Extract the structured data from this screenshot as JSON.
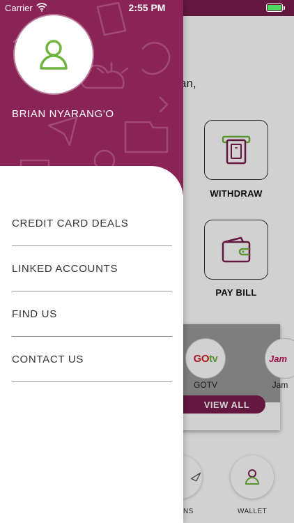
{
  "status_bar": {
    "carrier": "Carrier",
    "time": "2:55 PM",
    "battery_color": "#4cd964"
  },
  "drawer": {
    "brand_color": "#8a2356",
    "user_name": "BRIAN NYARANG'O",
    "avatar_icon": "user-icon",
    "avatar_icon_color": "#6fb43f",
    "menu": [
      {
        "label": "CREDIT CARD DEALS"
      },
      {
        "label": "LINKED ACCOUNTS"
      },
      {
        "label": "FIND US"
      },
      {
        "label": "CONTACT US"
      }
    ]
  },
  "background": {
    "greeting_fragment": "an,",
    "tiles": [
      {
        "label": "WITHDRAW",
        "icon": "atm-withdraw-icon"
      },
      {
        "label": "PAY BILL",
        "icon": "wallet-icon"
      }
    ],
    "billers": [
      {
        "name": "GOTV",
        "logo_text_a": "GO",
        "logo_text_b": "tv"
      },
      {
        "name": "Jam",
        "logo_text_a": "Jam"
      }
    ],
    "view_all_label": "VIEW ALL",
    "tabs": [
      {
        "label": "NS",
        "icon": "send-icon"
      },
      {
        "label": "WALLET",
        "icon": "user-icon"
      }
    ]
  }
}
